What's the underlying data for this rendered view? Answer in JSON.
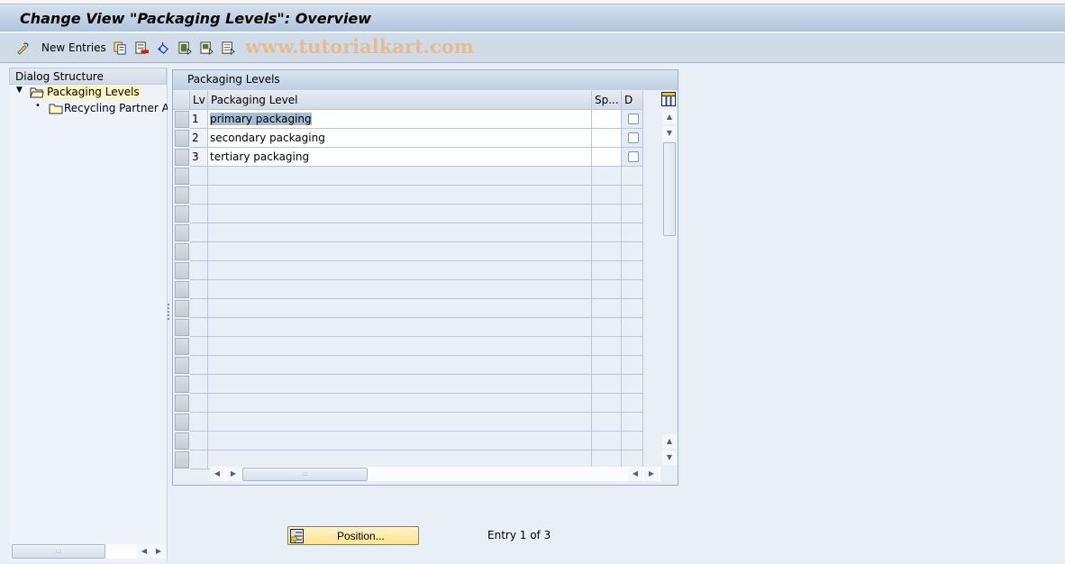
{
  "window": {
    "title": "Change View \"Packaging Levels\": Overview"
  },
  "toolbar": {
    "new_entries_label": "New Entries",
    "icons": [
      "display-change-icon",
      "copy-icon",
      "delete-icon",
      "undo-icon",
      "select-all-icon",
      "select-block-icon",
      "deselect-all-icon"
    ],
    "watermark": "www.tutorialkart.com"
  },
  "dialog_structure": {
    "header": "Dialog Structure",
    "items": [
      {
        "label": "Packaging Levels",
        "level": 0,
        "expanded": true,
        "selected": true
      },
      {
        "label": "Recycling Partner Ass",
        "level": 1,
        "expanded": false,
        "selected": false
      }
    ]
  },
  "table": {
    "title": "Packaging Levels",
    "columns": [
      {
        "key": "lv",
        "label": "Lv"
      },
      {
        "key": "level",
        "label": "Packaging Level"
      },
      {
        "key": "sp",
        "label": "Sp..."
      },
      {
        "key": "d",
        "label": "D"
      }
    ],
    "rows": [
      {
        "lv": "1",
        "level": "primary packaging",
        "sp": "",
        "d": false,
        "highlighted": true
      },
      {
        "lv": "2",
        "level": "secondary packaging",
        "sp": "",
        "d": false,
        "highlighted": false
      },
      {
        "lv": "3",
        "level": "tertiary packaging",
        "sp": "",
        "d": false,
        "highlighted": false
      }
    ],
    "empty_rows": 16
  },
  "footer": {
    "position_button": "Position...",
    "entry_info": "Entry 1 of 3"
  },
  "colors": {
    "title_bar": "#afc5dd",
    "toolbar": "#cfdce7",
    "background": "#e9eff7",
    "selection_highlight": "#a7bcd5",
    "tree_selected": "#fdf7ba",
    "position_button": "#fde48c"
  }
}
